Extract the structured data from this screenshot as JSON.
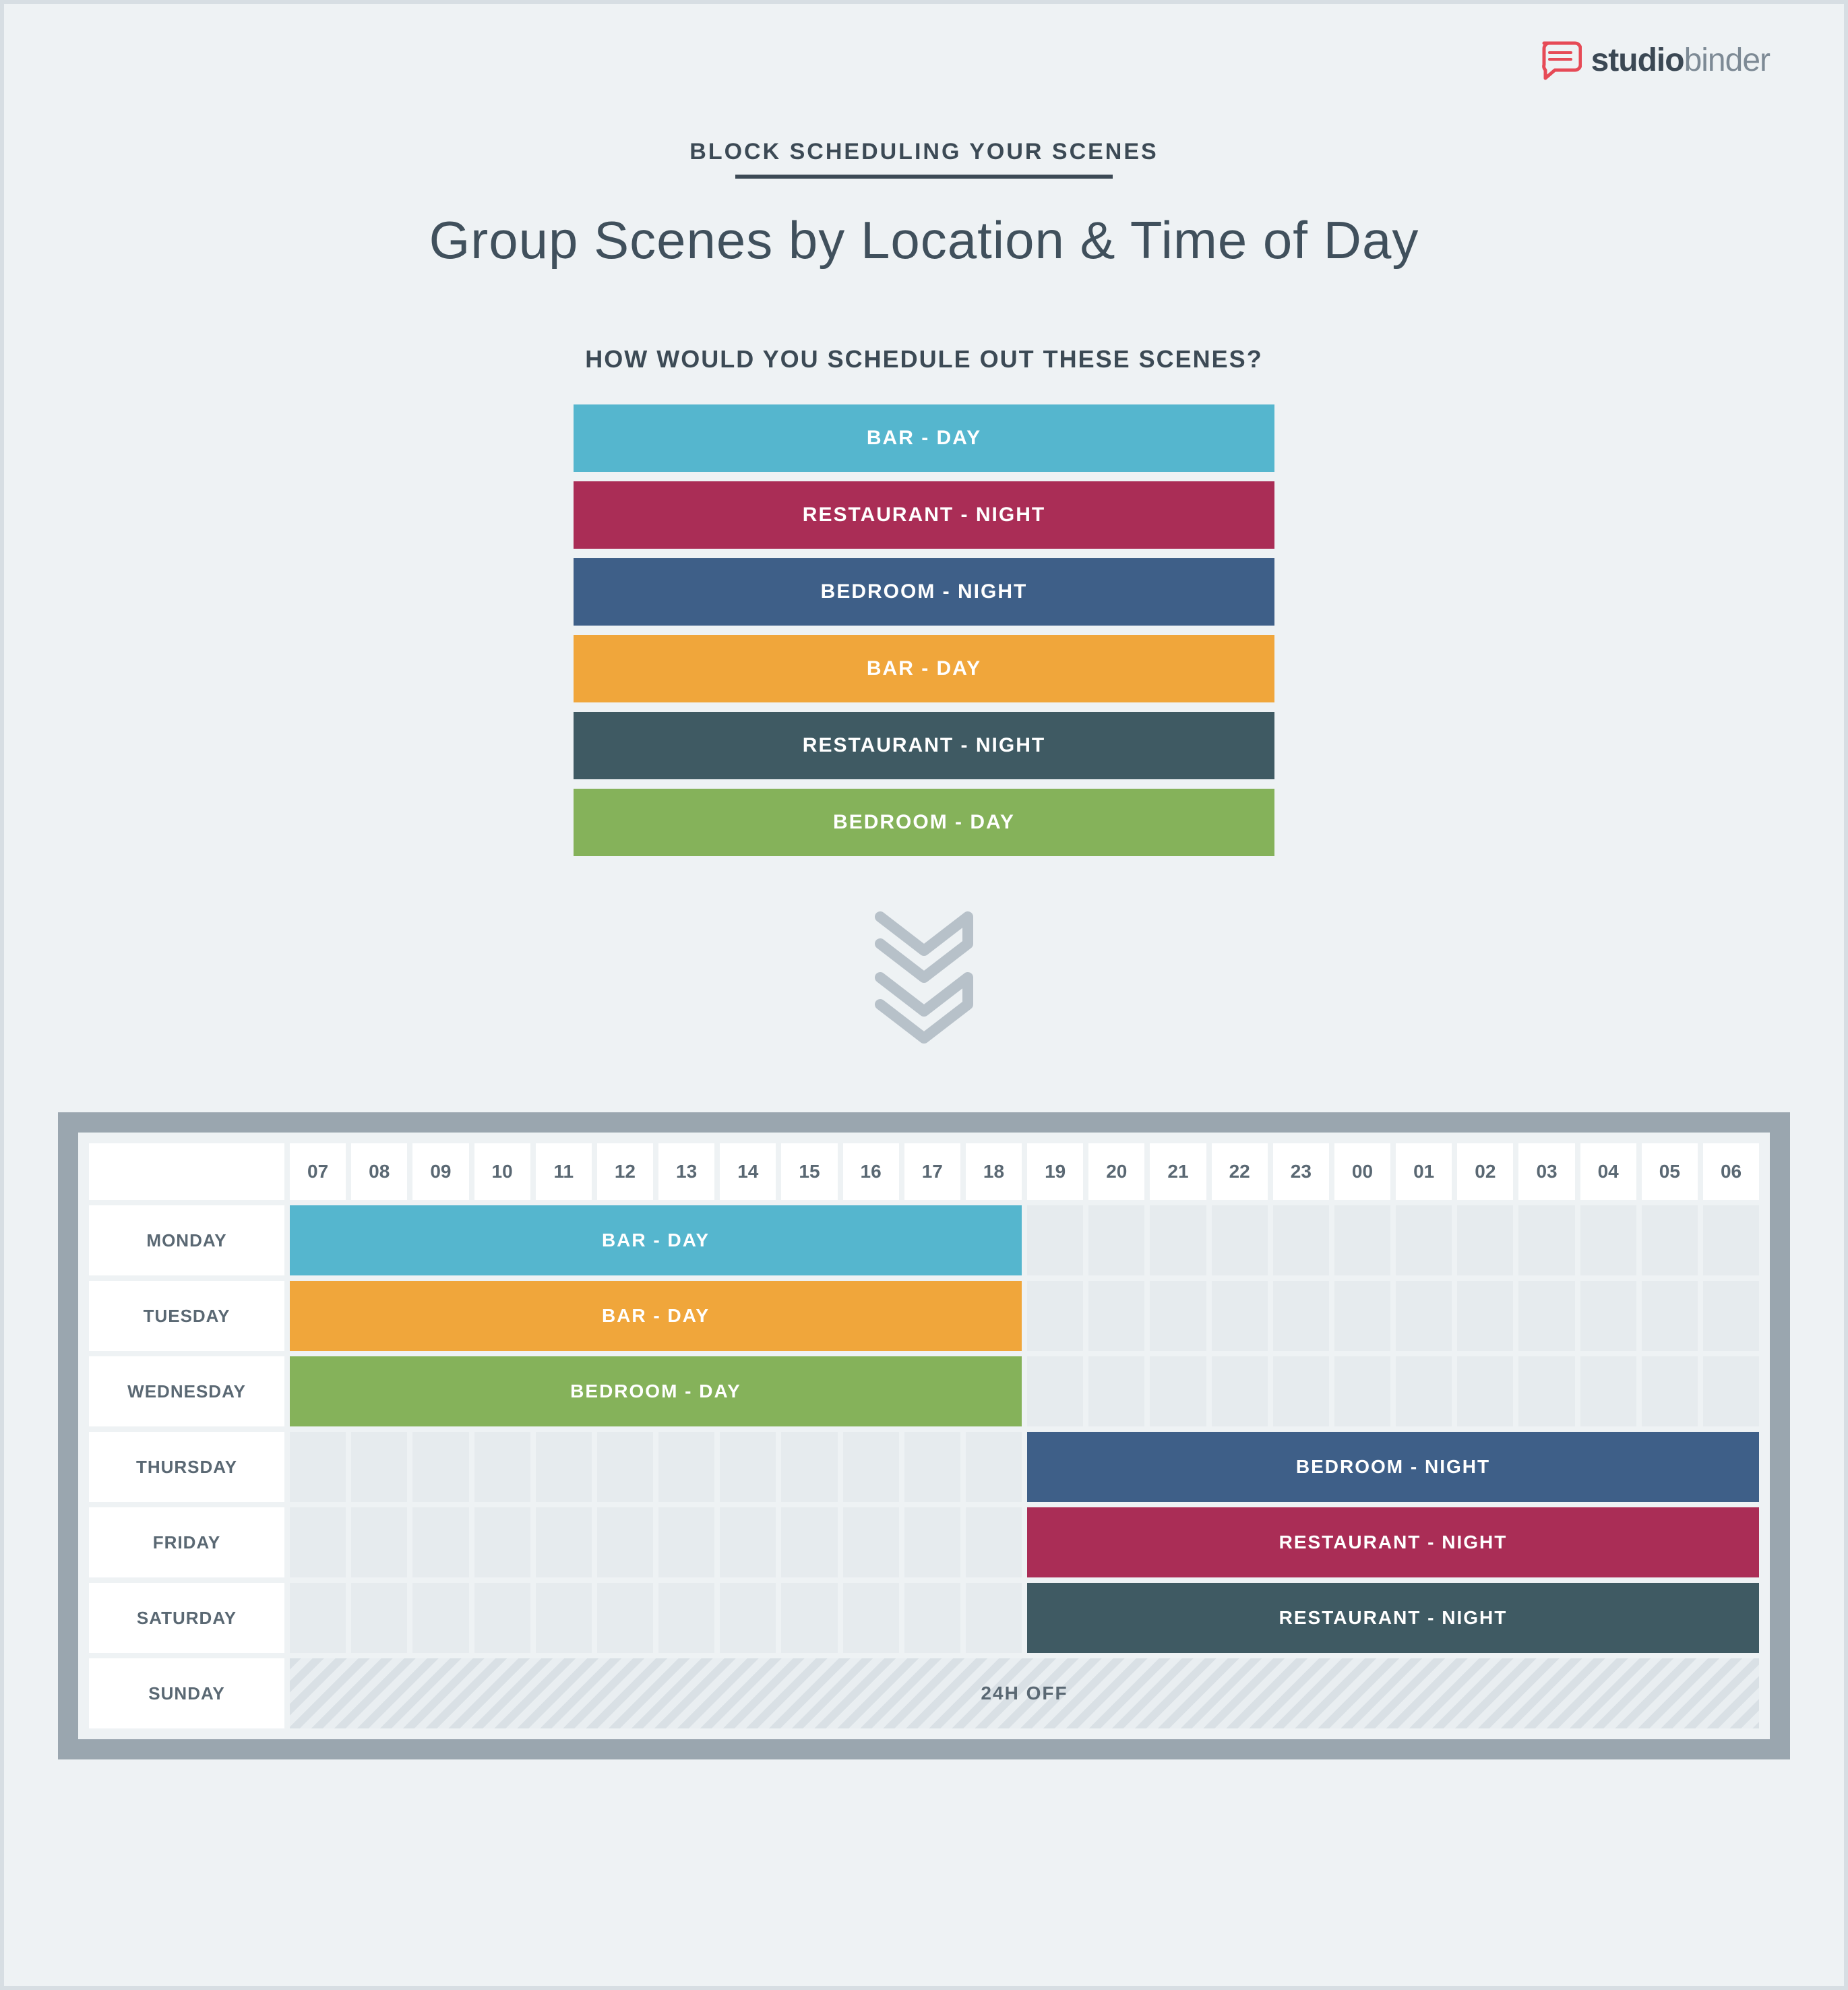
{
  "brand": {
    "name_bold": "studio",
    "name_light": "binder",
    "accent": "#e64a56"
  },
  "header": {
    "eyebrow": "BLOCK SCHEDULING YOUR SCENES",
    "title": "Group Scenes by Location & Time of Day",
    "question": "HOW WOULD YOU SCHEDULE OUT THESE SCENES?"
  },
  "strips": [
    {
      "label": "BAR - DAY",
      "color": "#55b6ce"
    },
    {
      "label": "RESTAURANT - NIGHT",
      "color": "#aa2d56"
    },
    {
      "label": "BEDROOM - NIGHT",
      "color": "#3e5f88"
    },
    {
      "label": "BAR - DAY",
      "color": "#f0a63b"
    },
    {
      "label": "RESTAURANT - NIGHT",
      "color": "#3f5a63"
    },
    {
      "label": "BEDROOM - DAY",
      "color": "#85b25a"
    }
  ],
  "schedule": {
    "hours": [
      "07",
      "08",
      "09",
      "10",
      "11",
      "12",
      "13",
      "14",
      "15",
      "16",
      "17",
      "18",
      "19",
      "20",
      "21",
      "22",
      "23",
      "00",
      "01",
      "02",
      "03",
      "04",
      "05",
      "06"
    ],
    "days": [
      {
        "name": "MONDAY",
        "event": {
          "label": "BAR - DAY",
          "color": "#55b6ce",
          "start": 0,
          "span": 12
        }
      },
      {
        "name": "TUESDAY",
        "event": {
          "label": "BAR - DAY",
          "color": "#f0a63b",
          "start": 0,
          "span": 12
        }
      },
      {
        "name": "WEDNESDAY",
        "event": {
          "label": "BEDROOM - DAY",
          "color": "#85b25a",
          "start": 0,
          "span": 12
        }
      },
      {
        "name": "THURSDAY",
        "event": {
          "label": "BEDROOM - NIGHT",
          "color": "#3e5f88",
          "start": 12,
          "span": 12
        }
      },
      {
        "name": "FRIDAY",
        "event": {
          "label": "RESTAURANT - NIGHT",
          "color": "#aa2d56",
          "start": 12,
          "span": 12
        }
      },
      {
        "name": "SATURDAY",
        "event": {
          "label": "RESTAURANT - NIGHT",
          "color": "#3f5a63",
          "start": 12,
          "span": 12
        }
      },
      {
        "name": "SUNDAY",
        "off": "24H OFF"
      }
    ]
  }
}
